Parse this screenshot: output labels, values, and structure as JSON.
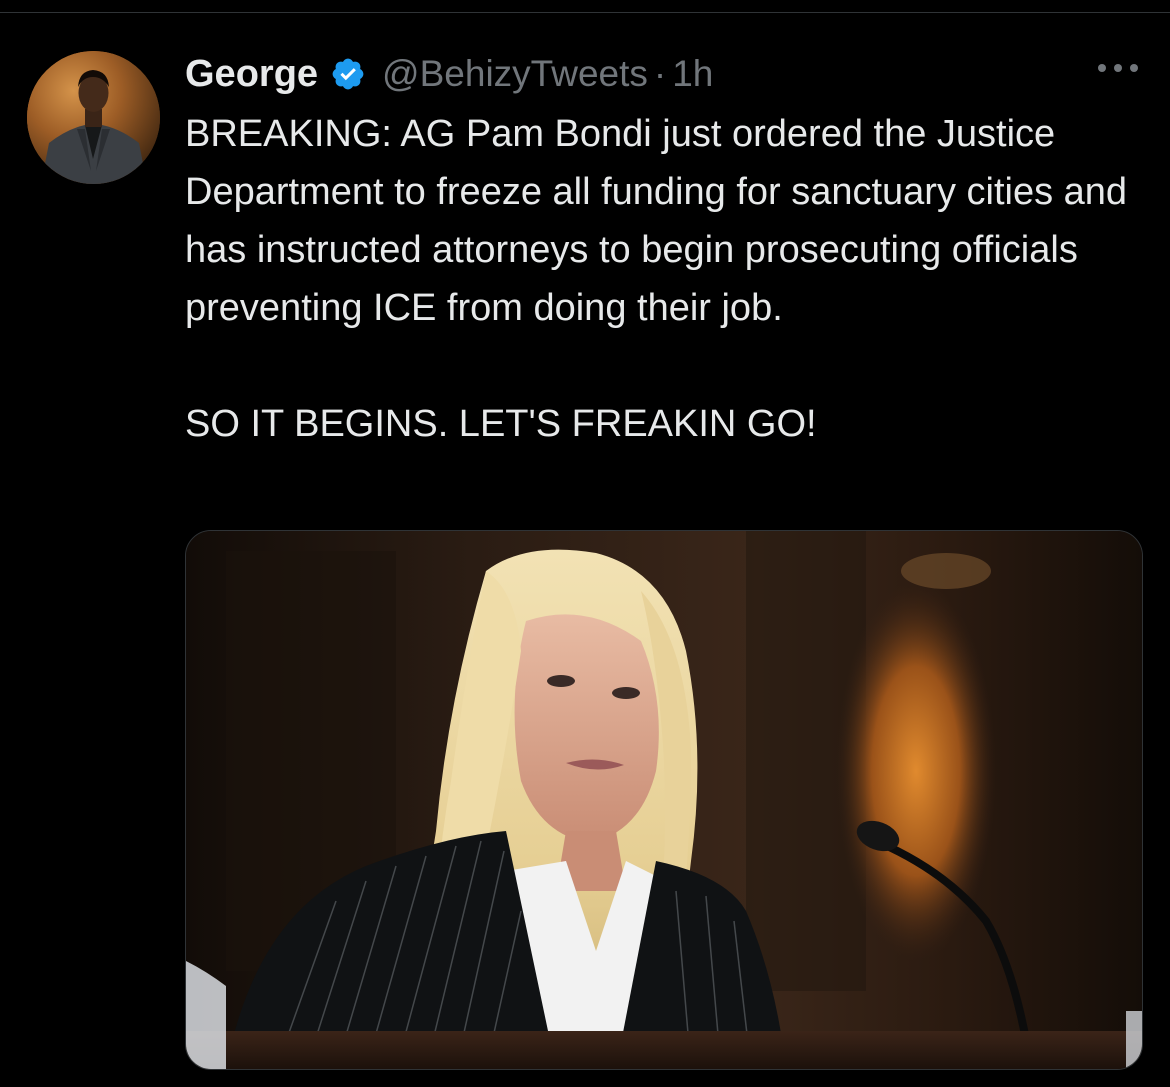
{
  "tweet": {
    "author": {
      "name": "George",
      "handle": "@BehizyTweets",
      "separator": "·",
      "time": "1h",
      "verified_color": "#1d9bf0"
    },
    "text": "BREAKING: AG Pam Bondi just ordered the Justice Department to freeze all funding for sanctuary cities and has instructed attorneys to begin prosecuting officials preventing ICE from doing their job.\n\nSO IT BEGINS. LET'S FREAKIN GO!"
  },
  "icons": {
    "verified": "verified-badge-icon",
    "more": "more-options-icon"
  },
  "colors": {
    "background": "#000000",
    "text_primary": "#e7e9ea",
    "text_secondary": "#71767b",
    "accent": "#1d9bf0",
    "divider": "#2f3336"
  }
}
